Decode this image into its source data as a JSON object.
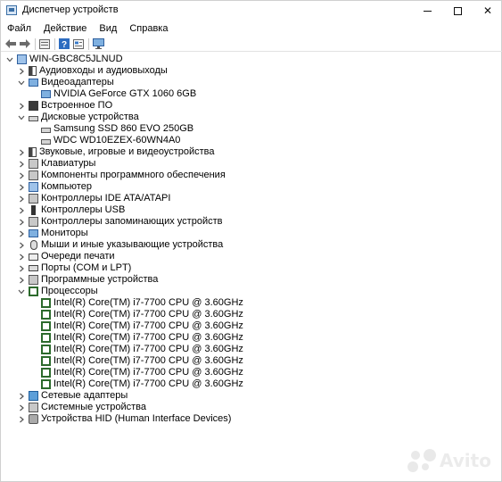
{
  "window": {
    "title": "Диспетчер устройств",
    "minimize_icon": "minimize-icon",
    "maximize_icon": "maximize-icon",
    "close_glyph": "✕"
  },
  "menu": [
    "Файл",
    "Действие",
    "Вид",
    "Справка"
  ],
  "toolbar": {
    "buttons": [
      "back-icon",
      "forward-icon",
      "properties-icon",
      "help-icon",
      "view-icon",
      "monitor-icon"
    ]
  },
  "tree": {
    "root": "WIN-GBC8C5JLNUD",
    "categories": [
      {
        "label": "Аудиовходы и аудиовыходы",
        "icon": "speaker-icon",
        "expanded": false
      },
      {
        "label": "Видеоадаптеры",
        "icon": "display-adapter-icon",
        "expanded": true,
        "children": [
          "NVIDIA GeForce GTX 1060 6GB"
        ]
      },
      {
        "label": "Встроенное ПО",
        "icon": "firmware-icon",
        "expanded": false
      },
      {
        "label": "Дисковые устройства",
        "icon": "disk-drive-icon",
        "expanded": true,
        "children": [
          "Samsung SSD 860 EVO 250GB",
          "WDC WD10EZEX-60WN4A0"
        ]
      },
      {
        "label": "Звуковые, игровые и видеоустройства",
        "icon": "sound-icon",
        "expanded": false
      },
      {
        "label": "Клавиатуры",
        "icon": "keyboard-icon",
        "expanded": false
      },
      {
        "label": "Компоненты программного обеспечения",
        "icon": "software-component-icon",
        "expanded": false
      },
      {
        "label": "Компьютер",
        "icon": "computer-icon",
        "expanded": false
      },
      {
        "label": "Контроллеры IDE ATA/ATAPI",
        "icon": "ide-controller-icon",
        "expanded": false
      },
      {
        "label": "Контроллеры USB",
        "icon": "usb-icon",
        "expanded": false
      },
      {
        "label": "Контроллеры запоминающих устройств",
        "icon": "storage-controller-icon",
        "expanded": false
      },
      {
        "label": "Мониторы",
        "icon": "monitor-icon",
        "expanded": false
      },
      {
        "label": "Мыши и иные указывающие устройства",
        "icon": "mouse-icon",
        "expanded": false
      },
      {
        "label": "Очереди печати",
        "icon": "printer-icon",
        "expanded": false
      },
      {
        "label": "Порты (COM и LPT)",
        "icon": "port-icon",
        "expanded": false
      },
      {
        "label": "Программные устройства",
        "icon": "software-device-icon",
        "expanded": false
      },
      {
        "label": "Процессоры",
        "icon": "processor-icon",
        "expanded": true,
        "children": [
          "Intel(R) Core(TM) i7-7700 CPU @ 3.60GHz",
          "Intel(R) Core(TM) i7-7700 CPU @ 3.60GHz",
          "Intel(R) Core(TM) i7-7700 CPU @ 3.60GHz",
          "Intel(R) Core(TM) i7-7700 CPU @ 3.60GHz",
          "Intel(R) Core(TM) i7-7700 CPU @ 3.60GHz",
          "Intel(R) Core(TM) i7-7700 CPU @ 3.60GHz",
          "Intel(R) Core(TM) i7-7700 CPU @ 3.60GHz",
          "Intel(R) Core(TM) i7-7700 CPU @ 3.60GHz"
        ]
      },
      {
        "label": "Сетевые адаптеры",
        "icon": "network-adapter-icon",
        "expanded": false
      },
      {
        "label": "Системные устройства",
        "icon": "system-device-icon",
        "expanded": false
      },
      {
        "label": "Устройства HID (Human Interface Devices)",
        "icon": "hid-icon",
        "expanded": false
      }
    ]
  },
  "watermark": {
    "text": "Avito",
    "icon": "avito-logo-icon"
  }
}
